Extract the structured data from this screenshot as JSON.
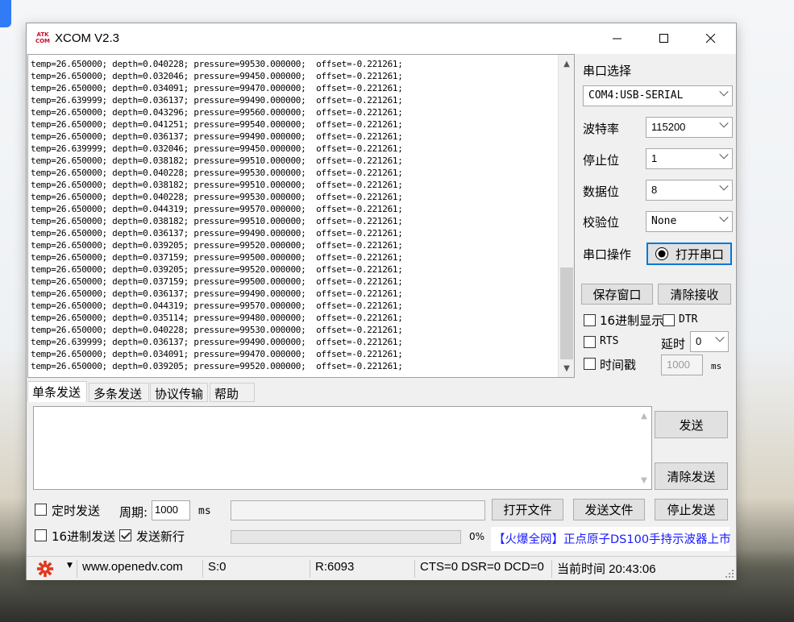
{
  "window": {
    "title": "XCOM V2.3",
    "logo_text": "ATK COM"
  },
  "receive": {
    "lines": [
      "temp=26.650000; depth=0.040228; pressure=99530.000000;  offset=-0.221261;",
      "temp=26.650000; depth=0.032046; pressure=99450.000000;  offset=-0.221261;",
      "temp=26.650000; depth=0.034091; pressure=99470.000000;  offset=-0.221261;",
      "temp=26.639999; depth=0.036137; pressure=99490.000000;  offset=-0.221261;",
      "temp=26.650000; depth=0.043296; pressure=99560.000000;  offset=-0.221261;",
      "temp=26.650000; depth=0.041251; pressure=99540.000000;  offset=-0.221261;",
      "temp=26.650000; depth=0.036137; pressure=99490.000000;  offset=-0.221261;",
      "temp=26.639999; depth=0.032046; pressure=99450.000000;  offset=-0.221261;",
      "temp=26.650000; depth=0.038182; pressure=99510.000000;  offset=-0.221261;",
      "temp=26.650000; depth=0.040228; pressure=99530.000000;  offset=-0.221261;",
      "temp=26.650000; depth=0.038182; pressure=99510.000000;  offset=-0.221261;",
      "temp=26.650000; depth=0.040228; pressure=99530.000000;  offset=-0.221261;",
      "temp=26.650000; depth=0.044319; pressure=99570.000000;  offset=-0.221261;",
      "temp=26.650000; depth=0.038182; pressure=99510.000000;  offset=-0.221261;",
      "temp=26.650000; depth=0.036137; pressure=99490.000000;  offset=-0.221261;",
      "temp=26.650000; depth=0.039205; pressure=99520.000000;  offset=-0.221261;",
      "temp=26.650000; depth=0.037159; pressure=99500.000000;  offset=-0.221261;",
      "temp=26.650000; depth=0.039205; pressure=99520.000000;  offset=-0.221261;",
      "temp=26.650000; depth=0.037159; pressure=99500.000000;  offset=-0.221261;",
      "temp=26.650000; depth=0.036137; pressure=99490.000000;  offset=-0.221261;",
      "temp=26.650000; depth=0.044319; pressure=99570.000000;  offset=-0.221261;",
      "temp=26.650000; depth=0.035114; pressure=99480.000000;  offset=-0.221261;",
      "temp=26.650000; depth=0.040228; pressure=99530.000000;  offset=-0.221261;",
      "temp=26.639999; depth=0.036137; pressure=99490.000000;  offset=-0.221261;",
      "temp=26.650000; depth=0.034091; pressure=99470.000000;  offset=-0.221261;",
      "temp=26.650000; depth=0.039205; pressure=99520.000000;  offset=-0.221261;"
    ]
  },
  "settings": {
    "port_select_label": "串口选择",
    "port_value": "COM4:USB-SERIAL",
    "baud_label": "波特率",
    "baud_value": "115200",
    "stopbits_label": "停止位",
    "stopbits_value": "1",
    "databits_label": "数据位",
    "databits_value": "8",
    "parity_label": "校验位",
    "parity_value": "None",
    "port_op_label": "串口操作",
    "open_port_button": "打开串口",
    "save_window_button": "保存窗口",
    "clear_receive_button": "清除接收",
    "hex_display_label": "16进制显示",
    "dtr_label": "DTR",
    "rts_label": "RTS",
    "delay_label": "延时",
    "delay_value": "0",
    "timestamp_label": "时间戳",
    "timestamp_value": "1000",
    "timestamp_unit": "ms"
  },
  "tabs": [
    "单条发送",
    "多条发送",
    "协议传输",
    "帮助"
  ],
  "send": {
    "send_button": "发送",
    "clear_send_button": "清除发送",
    "timed_send_label": "定时发送",
    "period_label": "周期:",
    "period_value": "1000",
    "period_unit": "ms",
    "open_file_button": "打开文件",
    "send_file_button": "发送文件",
    "stop_send_button": "停止发送",
    "hex_send_label": "16进制发送",
    "send_newline_label": "发送新行",
    "progress_text": "0%",
    "progress_value": 0,
    "ad_text": "【火爆全网】正点原子DS100手持示波器上市"
  },
  "status": {
    "url": "www.openedv.com",
    "sent": "S:0",
    "received": "R:6093",
    "lines": "CTS=0 DSR=0 DCD=0",
    "time": "当前时间 20:43:06"
  },
  "colors": {
    "accent_blue": "#0078d7",
    "ad_link": "#1a1aff",
    "gear_red": "#e03a1e"
  },
  "checks": {
    "timed_send": false,
    "hex_send": false,
    "send_newline": true,
    "hex_display": false,
    "dtr": false,
    "rts": false,
    "timestamp": false
  }
}
